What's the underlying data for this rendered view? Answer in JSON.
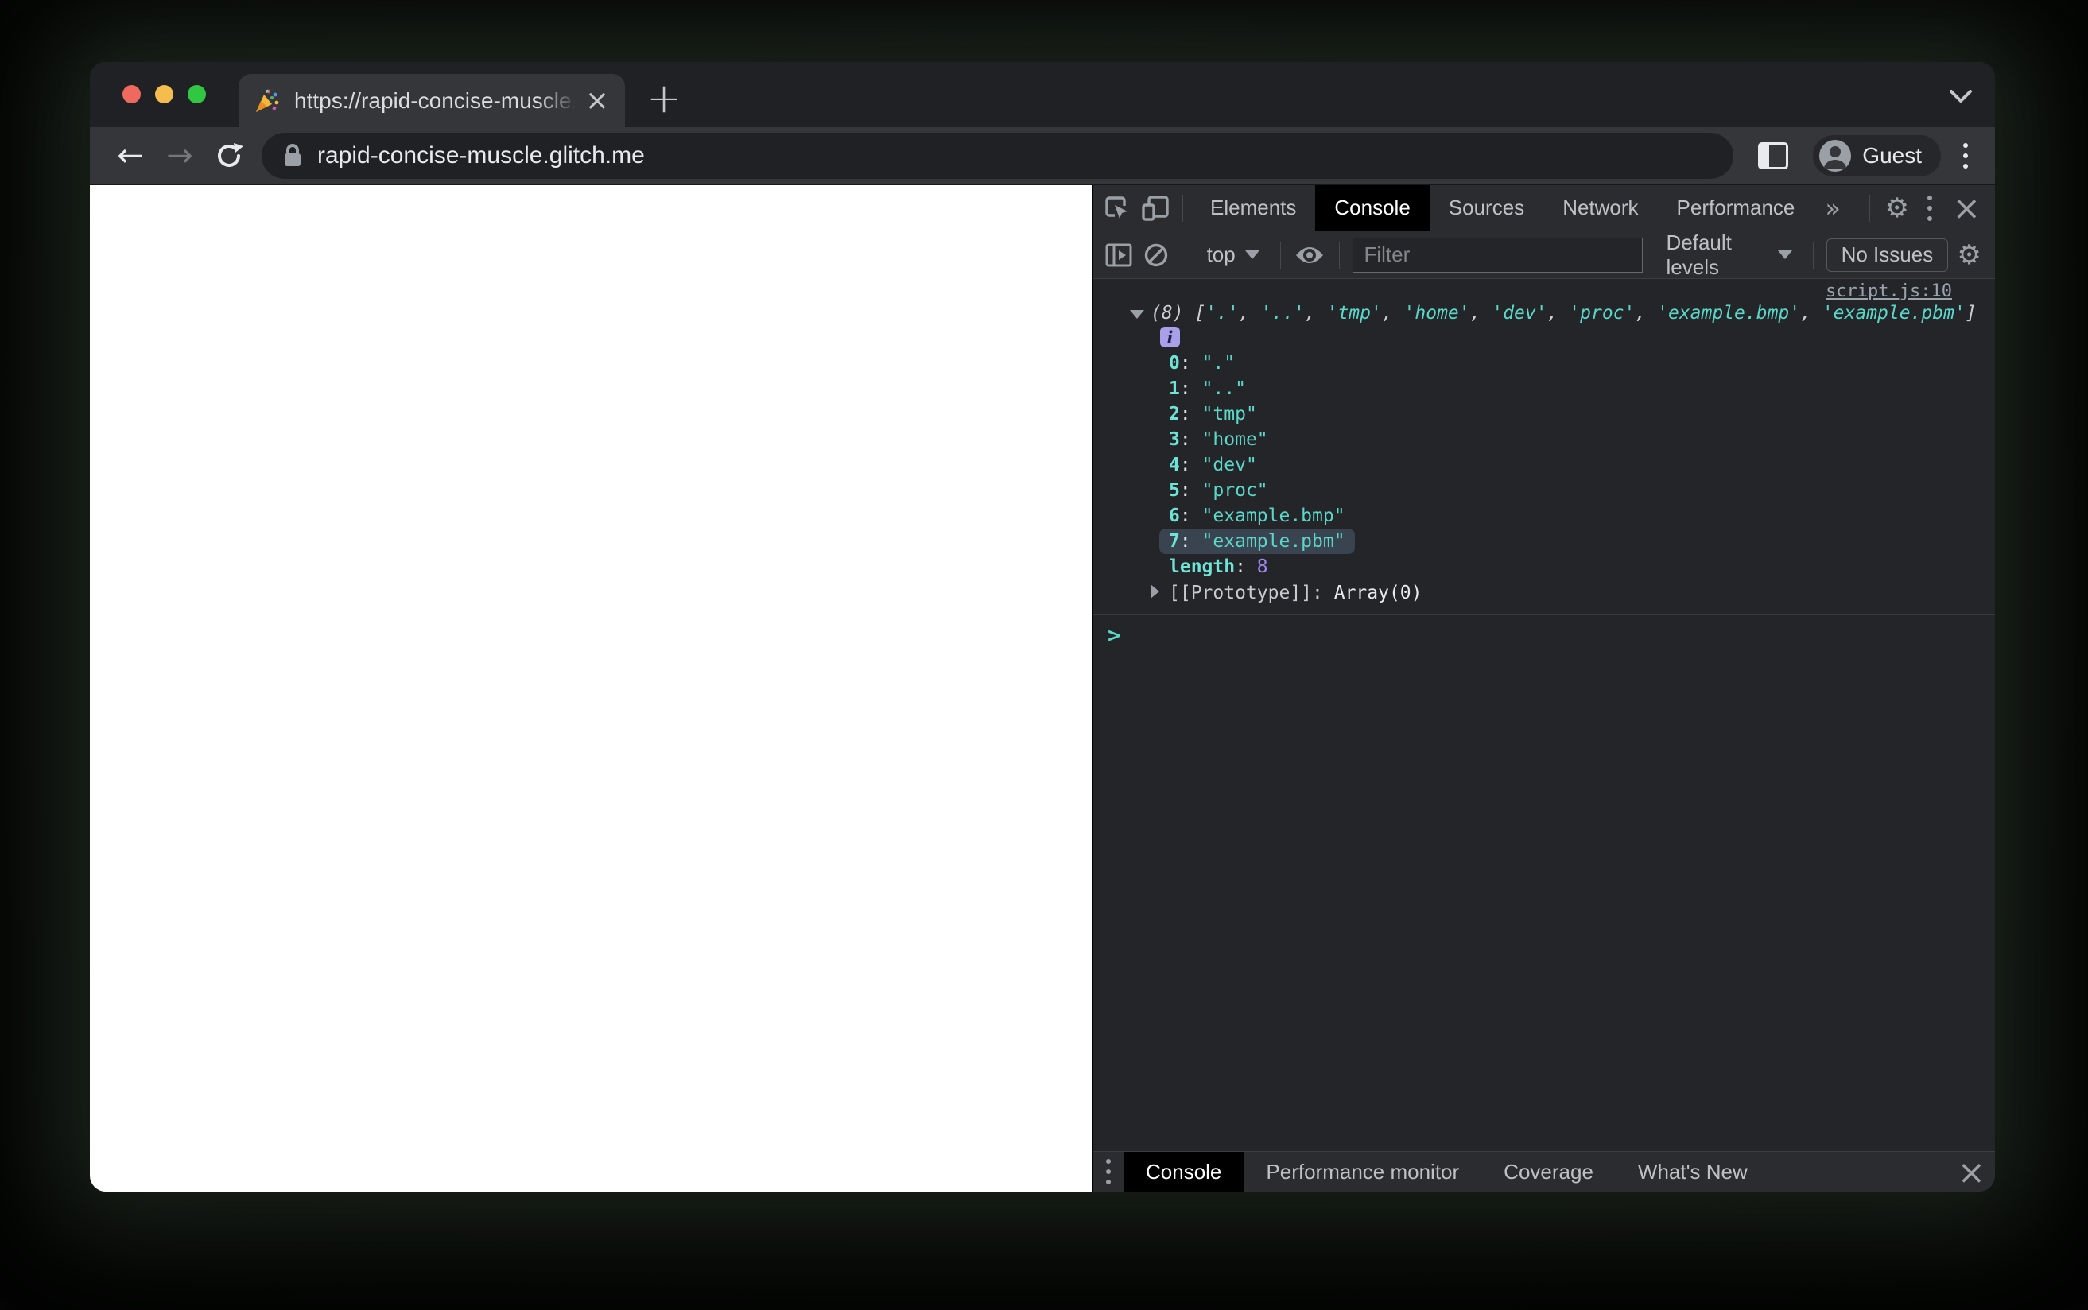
{
  "colors": {
    "string_teal": "#5bd6c8",
    "index_teal": "#6fe3d6",
    "number_purple": "#a187f2",
    "highlight_bg": "#3a4450"
  },
  "browser": {
    "tab_title": "https://rapid-concise-muscle.g",
    "new_tab_label": "+",
    "tab_close_label": "×",
    "url": "rapid-concise-muscle.glitch.me",
    "profile_label": "Guest"
  },
  "devtools": {
    "main_tabs": [
      "Elements",
      "Console",
      "Sources",
      "Network",
      "Performance"
    ],
    "active_main_tab": "Console",
    "more_tabs_label": "»",
    "gear_label": "⚙",
    "close_label": "×",
    "toolbar": {
      "context_selector": "top",
      "filter_placeholder": "Filter",
      "levels_label": "Default levels",
      "issues_label": "No Issues"
    },
    "console": {
      "source_link": "script.js:10",
      "array_count_prefix": "(8)",
      "array_values": [
        ".",
        "..",
        "tmp",
        "home",
        "dev",
        "proc",
        "example.bmp",
        "example.pbm"
      ],
      "highlighted_index": 7,
      "info_badge": "i",
      "length_label": "length",
      "length_value": "8",
      "prototype_label": "[[Prototype]]",
      "prototype_separator": ": ",
      "prototype_value": "Array(0)",
      "prompt": ">"
    },
    "drawer_tabs": [
      "Console",
      "Performance monitor",
      "Coverage",
      "What's New"
    ],
    "active_drawer_tab": "Console"
  }
}
